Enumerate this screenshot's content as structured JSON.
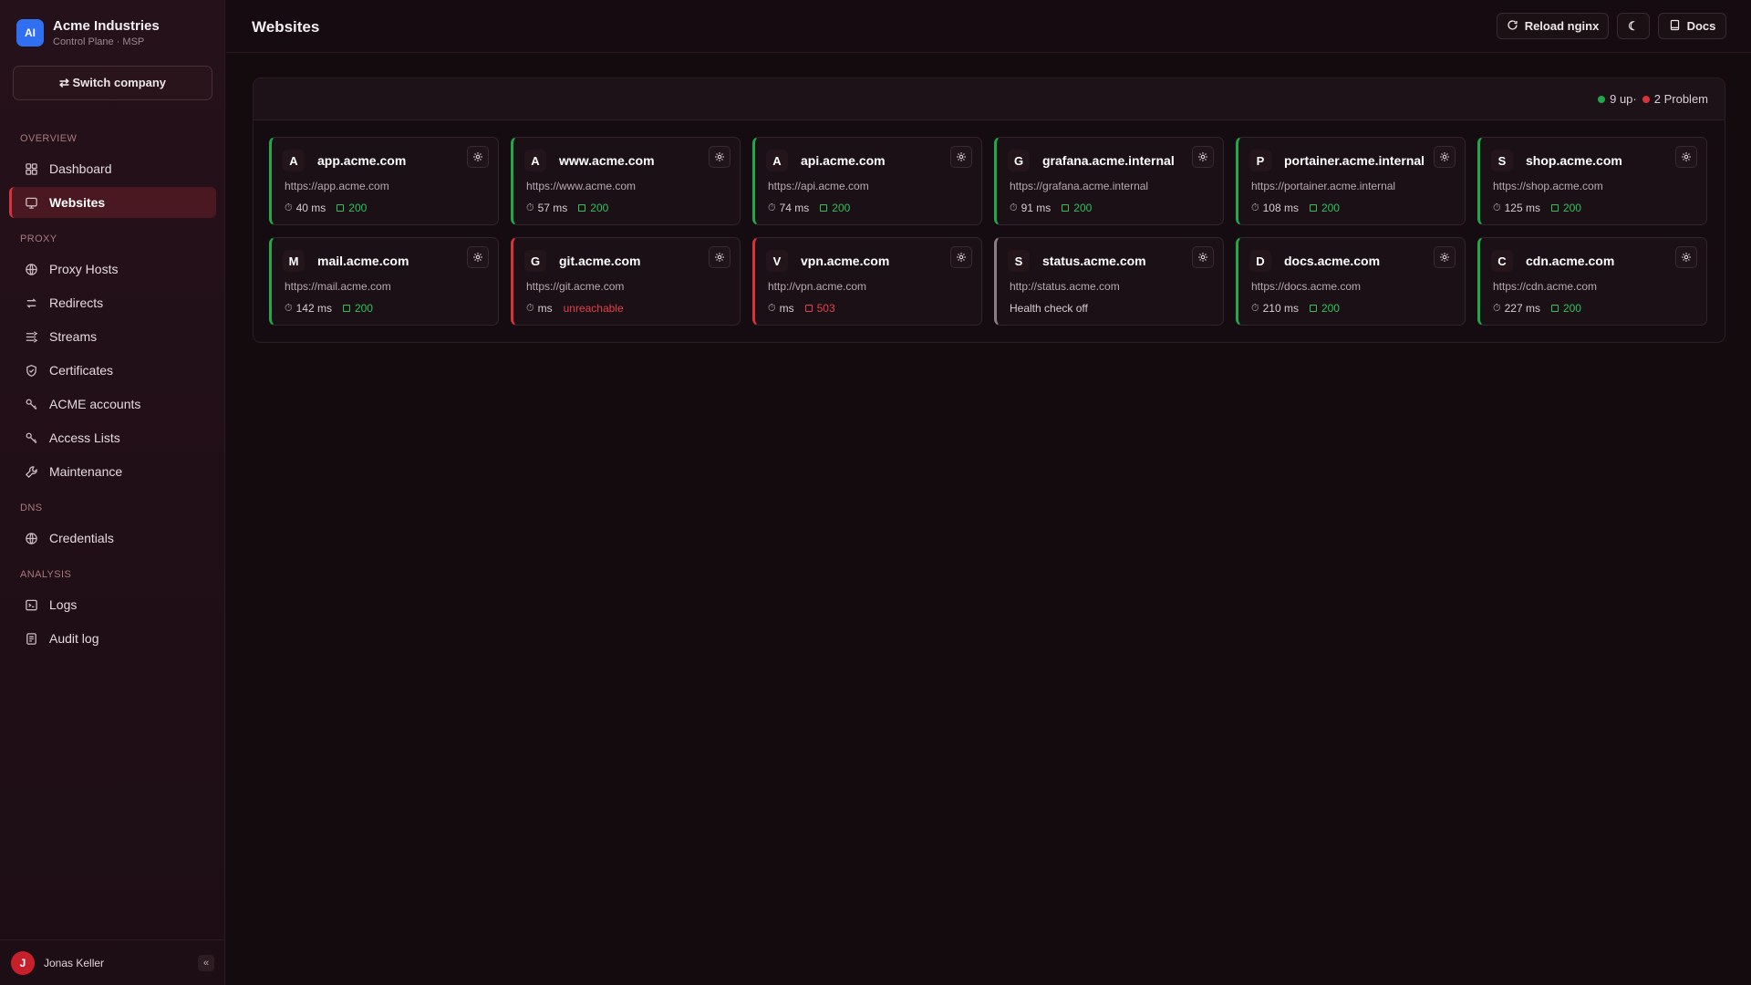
{
  "brand": {
    "logo": "AI",
    "name": "Acme Industries",
    "subtitle": "Control Plane · MSP"
  },
  "switch_company": "⇄ Switch company",
  "nav": {
    "overview": "OVERVIEW",
    "proxy": "PROXY",
    "dns": "DNS",
    "analysis": "ANALYSIS",
    "items": [
      {
        "label": "Dashboard",
        "icon": "dashboard-icon"
      },
      {
        "label": "Websites",
        "icon": "monitor-icon",
        "active": true
      },
      {
        "label": "Proxy Hosts",
        "icon": "globe-icon"
      },
      {
        "label": "Redirects",
        "icon": "redirect-icon"
      },
      {
        "label": "Streams",
        "icon": "streams-icon"
      },
      {
        "label": "Certificates",
        "icon": "shield-icon"
      },
      {
        "label": "ACME accounts",
        "icon": "key-icon"
      },
      {
        "label": "Access Lists",
        "icon": "key-icon"
      },
      {
        "label": "Maintenance",
        "icon": "wrench-icon"
      },
      {
        "label": "Credentials",
        "icon": "globe-icon"
      },
      {
        "label": "Logs",
        "icon": "terminal-icon"
      },
      {
        "label": "Audit log",
        "icon": "clipboard-icon"
      }
    ]
  },
  "user": {
    "initial": "J",
    "name": "Jonas Keller",
    "collapse": "«"
  },
  "header": {
    "title": "Websites",
    "reload": "Reload nginx",
    "theme": "☾",
    "docs": "Docs"
  },
  "summary": {
    "up": "9 up·",
    "problem": "2 Problem",
    "up_color": "#20a84a",
    "problem_color": "#d8323a"
  },
  "cards": [
    {
      "letter": "A",
      "host": "app.acme.com",
      "url": "https://app.acme.com",
      "ms": "40 ms",
      "code": "200",
      "state": "ok"
    },
    {
      "letter": "A",
      "host": "www.acme.com",
      "url": "https://www.acme.com",
      "ms": "57 ms",
      "code": "200",
      "state": "ok"
    },
    {
      "letter": "A",
      "host": "api.acme.com",
      "url": "https://api.acme.com",
      "ms": "74 ms",
      "code": "200",
      "state": "ok"
    },
    {
      "letter": "G",
      "host": "grafana.acme.internal",
      "url": "https://grafana.acme.internal",
      "ms": "91 ms",
      "code": "200",
      "state": "ok"
    },
    {
      "letter": "P",
      "host": "portainer.acme.internal",
      "url": "https://portainer.acme.internal",
      "ms": "108 ms",
      "code": "200",
      "state": "ok"
    },
    {
      "letter": "S",
      "host": "shop.acme.com",
      "url": "https://shop.acme.com",
      "ms": "125 ms",
      "code": "200",
      "state": "ok"
    },
    {
      "letter": "M",
      "host": "mail.acme.com",
      "url": "https://mail.acme.com",
      "ms": "142 ms",
      "code": "200",
      "state": "ok"
    },
    {
      "letter": "G",
      "host": "git.acme.com",
      "url": "https://git.acme.com",
      "ms": "ms",
      "code": "unreachable",
      "state": "err"
    },
    {
      "letter": "V",
      "host": "vpn.acme.com",
      "url": "http://vpn.acme.com",
      "ms": "ms",
      "code": "503",
      "state": "err"
    },
    {
      "letter": "S",
      "host": "status.acme.com",
      "url": "http://status.acme.com",
      "hc": "Health check off",
      "state": "off"
    },
    {
      "letter": "D",
      "host": "docs.acme.com",
      "url": "https://docs.acme.com",
      "ms": "210 ms",
      "code": "200",
      "state": "ok"
    },
    {
      "letter": "C",
      "host": "cdn.acme.com",
      "url": "https://cdn.acme.com",
      "ms": "227 ms",
      "code": "200",
      "state": "ok"
    }
  ]
}
